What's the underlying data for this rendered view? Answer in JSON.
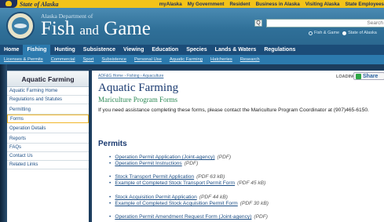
{
  "state_bar": {
    "brand": "State of Alaska",
    "links": [
      "myAlaska",
      "My Government",
      "Resident",
      "Business in Alaska",
      "Visiting Alaska",
      "State Employees"
    ]
  },
  "header": {
    "department": "Alaska Department of",
    "title_fish": "Fish",
    "title_and": "and",
    "title_game": "Game",
    "search": {
      "placeholder": "Search",
      "button_label": "Q"
    },
    "radios": [
      {
        "label": "Fish & Game",
        "selected": false
      },
      {
        "label": "State of Alaska",
        "selected": true
      }
    ]
  },
  "main_nav": [
    {
      "label": "Home",
      "active": false
    },
    {
      "label": "Fishing",
      "active": true
    },
    {
      "label": "Hunting",
      "active": false
    },
    {
      "label": "Subsistence",
      "active": false
    },
    {
      "label": "Viewing",
      "active": false
    },
    {
      "label": "Education",
      "active": false
    },
    {
      "label": "Species",
      "active": false
    },
    {
      "label": "Lands & Waters",
      "active": false
    },
    {
      "label": "Regulations",
      "active": false
    }
  ],
  "sub_nav": [
    "Licenses & Permits",
    "Commercial",
    "Sport",
    "Subsistence",
    "Personal Use",
    "Aquatic Farming",
    "Hatcheries",
    "Research"
  ],
  "sidebar": {
    "title": "Aquatic Farming",
    "groups": [
      [
        {
          "label": "Aquatic Farming Home",
          "active": false
        },
        {
          "label": "Regulations and Statutes",
          "active": false
        }
      ],
      [
        {
          "label": "Permitting",
          "active": false
        },
        {
          "label": "Forms",
          "active": true
        }
      ],
      [
        {
          "label": "Operation Details",
          "active": false
        }
      ],
      [
        {
          "label": "Reports",
          "active": false
        },
        {
          "label": "FAQs",
          "active": false
        },
        {
          "label": "Contact Us",
          "active": false
        },
        {
          "label": "Related Links",
          "active": false
        }
      ]
    ]
  },
  "main": {
    "breadcrumb": "ADF&G Home › Fishing › Aquaculture",
    "loading": "LOADING...",
    "share": "Share",
    "title": "Aquatic Farming",
    "subtitle": "Mariculture Program Forms",
    "intro": "If you need assistance completing these forms, please contact the Mariculture Program Coordinator at (907)465-6150.",
    "section": "Permits",
    "doc_groups": [
      [
        {
          "link": "Operation Permit Application (Joint-agency)",
          "note": "(PDF)"
        },
        {
          "link": "Operation Permit Instructions",
          "note": "(PDF)"
        }
      ],
      [
        {
          "link": "Stock Transport Permit Application",
          "note": "(PDF 63 kB)"
        },
        {
          "link": "Example of Completed Stock Transport Permit Form",
          "note": "(PDF 45 kB)"
        }
      ],
      [
        {
          "link": "Stock Acquisition Permit Application",
          "note": "(PDF 44 kB)"
        },
        {
          "link": "Example of Completed Stock Acquisition Permit Form",
          "note": "(PDF 30 kB)"
        }
      ],
      [
        {
          "link": "Operation  Permit Amendment Request Form (Joint-agency)",
          "note": "(PDF)"
        }
      ]
    ]
  },
  "colors": {
    "state_bar": "#f3c319",
    "header": "#2f6f98",
    "main_nav": "#1b4c78",
    "sub_nav": "#2c7aae",
    "link": "#1d4f86",
    "subtitle": "#2e8a57"
  }
}
